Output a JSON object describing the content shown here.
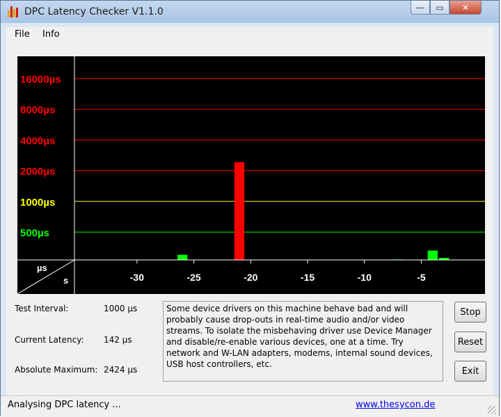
{
  "window": {
    "title": "DPC Latency Checker V1.1.0",
    "minimize_glyph": "—",
    "maximize_glyph": "▭",
    "close_glyph": "✕"
  },
  "menu": {
    "items": [
      "File",
      "Info"
    ]
  },
  "chart_data": {
    "type": "bar",
    "ylabel": "µs",
    "xlabel": "s",
    "y_scale": "log",
    "grid_lines": [
      {
        "value": 16000,
        "label": "16000µs",
        "color": "#ff0000"
      },
      {
        "value": 8000,
        "label": "8000µs",
        "color": "#ff0000"
      },
      {
        "value": 4000,
        "label": "4000µs",
        "color": "#ff0000"
      },
      {
        "value": 2000,
        "label": "2000µs",
        "color": "#ff0000"
      },
      {
        "value": 1000,
        "label": "1000µs",
        "color": "#ffff00"
      },
      {
        "value": 500,
        "label": "500µs",
        "color": "#00ff00"
      }
    ],
    "x_ticks": [
      -30,
      -25,
      -20,
      -15,
      -10,
      -5
    ],
    "x_range": [
      -35,
      0
    ],
    "x_tick_labels": [
      "-30",
      "-25",
      "-20",
      "-15",
      "-10",
      "-5"
    ],
    "categories": [
      -35,
      -34,
      -33,
      -32,
      -31,
      -30,
      -29,
      -28,
      -27,
      -26,
      -25,
      -24,
      -23,
      -22,
      -21,
      -20,
      -19,
      -18,
      -17,
      -16,
      -15,
      -14,
      -13,
      -12,
      -11,
      -10,
      -9,
      -8,
      -7,
      -6,
      -5,
      -4,
      -3,
      -2,
      -1,
      0
    ],
    "values": [
      200,
      200,
      200,
      200,
      200,
      230,
      230,
      200,
      220,
      300,
      200,
      210,
      200,
      230,
      2424,
      170,
      190,
      170,
      240,
      210,
      210,
      180,
      210,
      170,
      190,
      210,
      220,
      200,
      270,
      170,
      220,
      330,
      280,
      200,
      200,
      200
    ],
    "bar_colors": [
      "#00ff00",
      "#00ff00",
      "#00ff00",
      "#00ff00",
      "#00ff00",
      "#00ff00",
      "#00ff00",
      "#00ff00",
      "#00ff00",
      "#00ff00",
      "#00ff00",
      "#00ff00",
      "#00ff00",
      "#00ff00",
      "#ff0000",
      "#00ff00",
      "#00ff00",
      "#00ff00",
      "#00ff00",
      "#00ff00",
      "#00ff00",
      "#00ff00",
      "#00ff00",
      "#00ff00",
      "#00ff00",
      "#00ff00",
      "#00ff00",
      "#00ff00",
      "#00ff00",
      "#00ff00",
      "#00ff00",
      "#00ff00",
      "#00ff00",
      "#00ff00",
      "#00ff00",
      "#00ff00"
    ]
  },
  "stats": {
    "test_interval_label": "Test Interval:",
    "test_interval_value": "1000 µs",
    "current_latency_label": "Current Latency:",
    "current_latency_value": "142 µs",
    "absolute_max_label": "Absolute Maximum:",
    "absolute_max_value": "2424 µs"
  },
  "message": "Some device drivers on this machine behave bad and will probably cause drop-outs in real-time audio and/or video streams. To isolate the misbehaving driver use Device Manager and disable/re-enable various devices, one at a time. Try network and W-LAN adapters, modems, internal sound devices, USB host controllers, etc.",
  "buttons": {
    "stop": "Stop",
    "reset": "Reset",
    "exit": "Exit"
  },
  "status": {
    "text": "Analysing DPC latency ...",
    "link": "www.thesycon.de"
  }
}
